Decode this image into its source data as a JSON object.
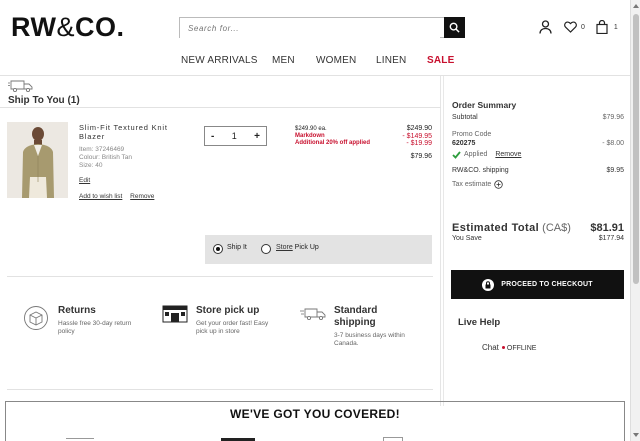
{
  "header": {
    "logo_bold": "RW",
    "logo_amp": "&",
    "logo_rest": "CO.",
    "search_placeholder": "Search for...",
    "wishlist_count": "0",
    "cart_count": "1"
  },
  "nav": {
    "items": [
      "NEW ARRIVALS",
      "MEN",
      "WOMEN",
      "LINEN",
      "SALE"
    ]
  },
  "cart": {
    "ship_title": "Ship To You (1)",
    "product": {
      "name": "Slim-Fit Textured Knit Blazer",
      "item": "Item: 37246469",
      "colour": "Colour: British Tan",
      "size": "Size: 40",
      "edit": "Edit",
      "wishlist": "Add to wish list",
      "remove": "Remove",
      "qty": "1",
      "qty_minus": "-",
      "qty_plus": "+",
      "price_each": "$249.90 ea.",
      "markdown_label": "Markdown",
      "additional_label": "Additional 20% off applied",
      "price_orig": "$249.90",
      "markdown_amount": "- $149.95",
      "additional_amount": "- $19.99",
      "final_price": "$79.96"
    },
    "ship_it": "Ship It",
    "store_pickup_link": "Store",
    "store_pickup_rest": " Pick Up"
  },
  "features": [
    {
      "title": "Returns",
      "desc": "Hassle free 30-day return policy"
    },
    {
      "title": "Store pick up",
      "desc": "Get your order fast! Easy pick up in store"
    },
    {
      "title": "Standard shipping",
      "desc": "3-7 business days within Canada."
    }
  ],
  "summary": {
    "title": "Order Summary",
    "subtotal_label": "Subtotal",
    "subtotal": "$79.96",
    "promo_label": "Promo Code",
    "promo_code": "620275",
    "promo_amount": "- $8.00",
    "applied": "Applied",
    "remove": "Remove",
    "shipping_label": "RW&CO. shipping",
    "shipping": "$9.95",
    "tax_label": "Tax estimate",
    "est_total_label": "Estimated Total",
    "currency": "(CA$)",
    "est_total": "$81.91",
    "you_save_label": "You Save",
    "you_save": "$177.94",
    "checkout": "PROCEED TO CHECKOUT",
    "live_help": "Live Help",
    "chat": "Chat",
    "offline": "OFFLINE"
  },
  "banner": {
    "title": "WE'VE GOT YOU COVERED!"
  },
  "colors": {
    "accent_red": "#c8102e",
    "dark": "#111111",
    "check_green": "#2e9e3e"
  }
}
